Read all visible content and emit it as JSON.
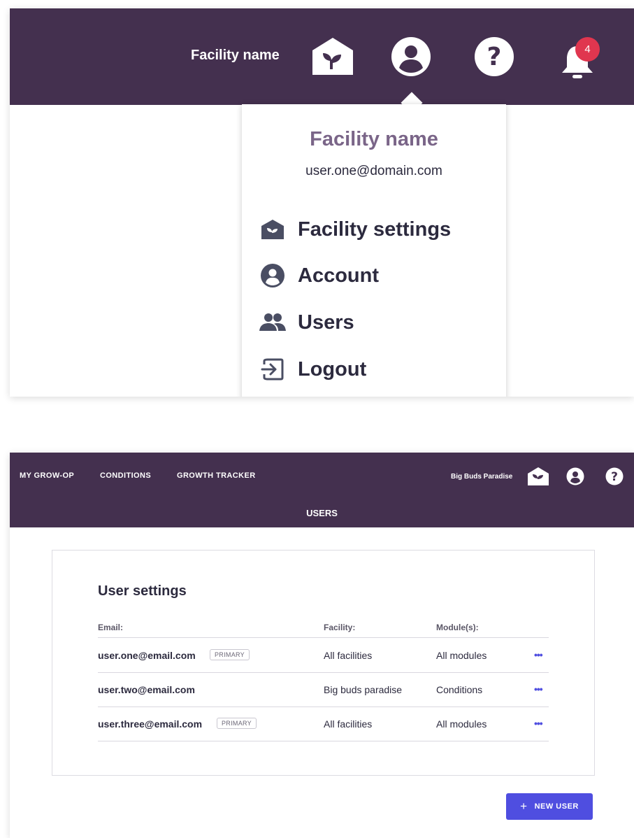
{
  "colors": {
    "header_bg": "#44304f",
    "accent": "#4f4ee0",
    "badge": "#e0364f",
    "dropdown_title": "#7a6588"
  },
  "top_header": {
    "facility_name": "Facility name",
    "icons": [
      "facility-icon",
      "account-icon",
      "help-icon",
      "bell-icon"
    ],
    "notification_count": "4"
  },
  "dropdown": {
    "title": "Facility name",
    "email": "user.one@domain.com",
    "items": [
      {
        "label": "Facility settings",
        "icon": "facility-icon"
      },
      {
        "label": "Account",
        "icon": "account-icon"
      },
      {
        "label": "Users",
        "icon": "users-icon"
      },
      {
        "label": "Logout",
        "icon": "logout-icon"
      }
    ]
  },
  "app_header": {
    "nav": [
      "MY GROW-OP",
      "CONDITIONS",
      "GROWTH TRACKER"
    ],
    "facility_name": "Big Buds Paradise",
    "page_tab": "USERS"
  },
  "user_settings": {
    "title": "User settings",
    "columns": [
      "Email:",
      "Facility:",
      "Module(s):"
    ],
    "rows": [
      {
        "email": "user.one@email.com",
        "tag": "PRIMARY",
        "facility": "All facilities",
        "modules": "All modules",
        "more": "•••"
      },
      {
        "email": "user.two@email.com",
        "tag": "",
        "facility": "Big buds paradise",
        "modules": "Conditions",
        "more": "•••"
      },
      {
        "email": "user.three@email.com",
        "tag": "PRIMARY",
        "facility": "All facilities",
        "modules": "All modules",
        "more": "•••"
      }
    ],
    "new_user_label": "NEW USER",
    "new_user_icon": "plus-icon"
  }
}
